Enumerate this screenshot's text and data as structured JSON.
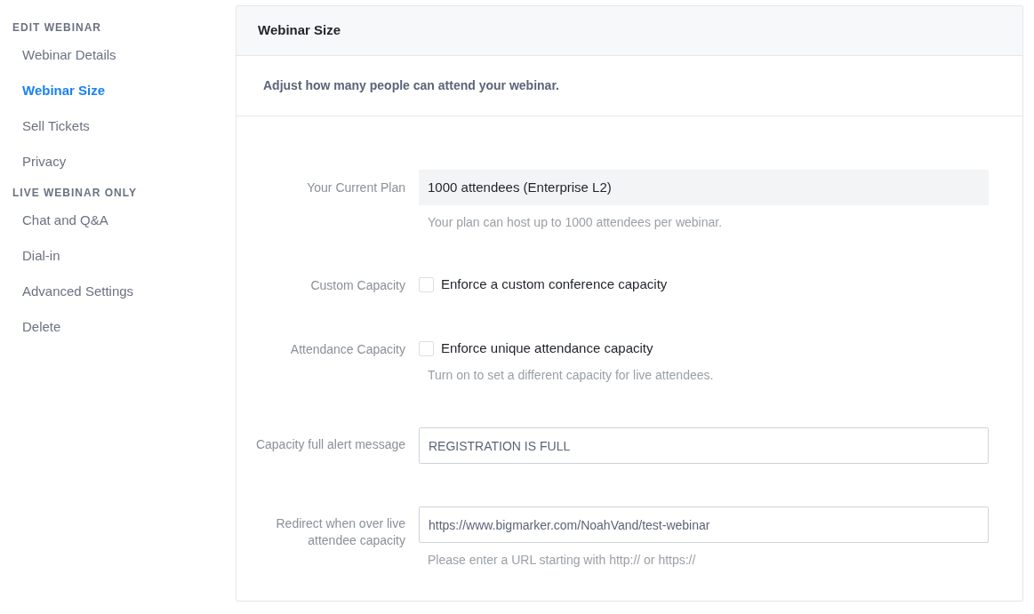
{
  "sidebar": {
    "sections": [
      {
        "heading": "EDIT WEBINAR",
        "items": [
          {
            "label": "Webinar Details",
            "selected": false
          },
          {
            "label": "Webinar Size",
            "selected": true
          },
          {
            "label": "Sell Tickets",
            "selected": false
          },
          {
            "label": "Privacy",
            "selected": false
          }
        ]
      },
      {
        "heading": "LIVE WEBINAR ONLY",
        "items": [
          {
            "label": "Chat and Q&A",
            "selected": false
          },
          {
            "label": "Dial-in",
            "selected": false
          },
          {
            "label": "Advanced Settings",
            "selected": false
          },
          {
            "label": "Delete",
            "selected": false
          }
        ]
      }
    ]
  },
  "panel": {
    "title": "Webinar Size",
    "description": "Adjust how many people can attend your webinar.",
    "rows": [
      {
        "kind": "readonly",
        "label": "Your Current Plan",
        "value": "1000 attendees (Enterprise L2)",
        "help": "Your plan can host up to 1000 attendees per webinar."
      },
      {
        "kind": "checkbox",
        "label": "Custom Capacity",
        "text": "Enforce a custom conference capacity",
        "checked": false
      },
      {
        "kind": "checkbox",
        "label": "Attendance Capacity",
        "text": "Enforce unique attendance capacity",
        "checked": false,
        "help": "Turn on to set a different capacity for live attendees."
      },
      {
        "kind": "input",
        "label": "Capacity full alert message",
        "value": "REGISTRATION IS FULL"
      },
      {
        "kind": "input",
        "label": "Redirect when over live attendee capacity",
        "value": "https://www.bigmarker.com/NoahVand/test-webinar",
        "help": "Please enter a URL starting with http:// or https://"
      }
    ]
  }
}
